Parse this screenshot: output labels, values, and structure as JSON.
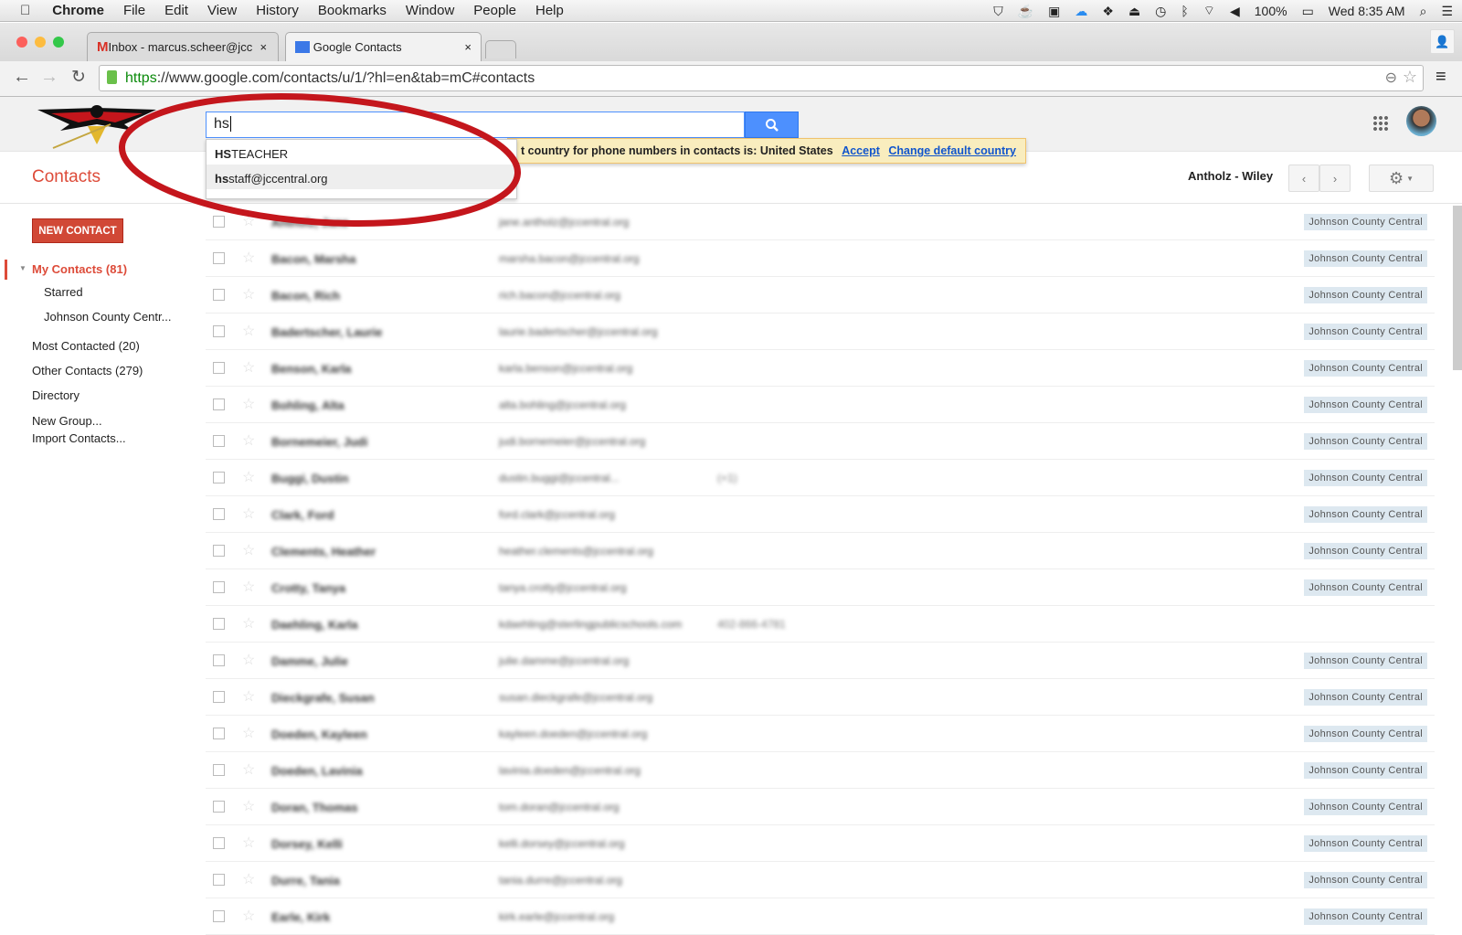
{
  "menubar": {
    "app": "Chrome",
    "items": [
      "File",
      "Edit",
      "View",
      "History",
      "Bookmarks",
      "Window",
      "People",
      "Help"
    ],
    "battery": "100%",
    "clock": "Wed 8:35 AM"
  },
  "tabs": [
    {
      "label": "Inbox - marcus.scheer@jcc",
      "active": false
    },
    {
      "label": "Google Contacts",
      "active": true
    }
  ],
  "url": {
    "scheme": "https",
    "rest": "://www.google.com/contacts/u/1/?hl=en&tab=mC#contacts"
  },
  "search": {
    "value": "hs",
    "suggestions": [
      {
        "bold": "HS",
        "rest": "TEACHER"
      },
      {
        "bold": "hs",
        "rest": "staff@jccentral.org"
      }
    ]
  },
  "notice": {
    "text": "t country for phone numbers in contacts is: United States",
    "accept": "Accept",
    "change": "Change default country"
  },
  "page_title": "Contacts",
  "range": "Antholz - Wiley",
  "new_contact": "NEW CONTACT",
  "sidebar": {
    "my_contacts": "My Contacts (81)",
    "sub": [
      "Starred",
      "Johnson County Centr..."
    ],
    "items": [
      "Most Contacted (20)",
      "Other Contacts (279)",
      "Directory"
    ],
    "links": [
      "New Group...",
      "Import Contacts..."
    ]
  },
  "colors": {
    "accent": "#dd4b39",
    "search_blue": "#4d90fe",
    "annotation": "#c4161c"
  },
  "contacts": [
    {
      "name": "Antholz, Jane",
      "email": "jane.antholz@jccentral.org",
      "tag": "Johnson County Central"
    },
    {
      "name": "Bacon, Marsha",
      "email": "marsha.bacon@jccentral.org",
      "tag": "Johnson County Central"
    },
    {
      "name": "Bacon, Rich",
      "email": "rich.bacon@jccentral.org",
      "tag": "Johnson County Central"
    },
    {
      "name": "Badertscher, Laurie",
      "email": "laurie.badertscher@jccentral.org",
      "tag": "Johnson County Central"
    },
    {
      "name": "Benson, Karla",
      "email": "karla.benson@jccentral.org",
      "tag": "Johnson County Central"
    },
    {
      "name": "Bohling, Alta",
      "email": "alta.bohling@jccentral.org",
      "tag": "Johnson County Central"
    },
    {
      "name": "Bornemeier, Judi",
      "email": "judi.bornemeier@jccentral.org",
      "tag": "Johnson County Central"
    },
    {
      "name": "Buggi, Dustin",
      "email": "dustin.buggi@jccentral...",
      "extra": "(+1)",
      "tag": "Johnson County Central"
    },
    {
      "name": "Clark, Ford",
      "email": "ford.clark@jccentral.org",
      "tag": "Johnson County Central"
    },
    {
      "name": "Clements, Heather",
      "email": "heather.clements@jccentral.org",
      "tag": "Johnson County Central"
    },
    {
      "name": "Crotty, Tanya",
      "email": "tanya.crotty@jccentral.org",
      "tag": "Johnson County Central"
    },
    {
      "name": "Daehling, Karla",
      "email": "kdaehling@sterlingpublicschools.com",
      "extra": "402-866-4781",
      "tag": ""
    },
    {
      "name": "Damme, Julie",
      "email": "julie.damme@jccentral.org",
      "tag": "Johnson County Central"
    },
    {
      "name": "Dieckgrafe, Susan",
      "email": "susan.dieckgrafe@jccentral.org",
      "tag": "Johnson County Central"
    },
    {
      "name": "Doeden, Kayleen",
      "email": "kayleen.doeden@jccentral.org",
      "tag": "Johnson County Central"
    },
    {
      "name": "Doeden, Lavinia",
      "email": "lavinia.doeden@jccentral.org",
      "tag": "Johnson County Central"
    },
    {
      "name": "Doran, Thomas",
      "email": "tom.doran@jccentral.org",
      "tag": "Johnson County Central"
    },
    {
      "name": "Dorsey, Kelli",
      "email": "kelli.dorsey@jccentral.org",
      "tag": "Johnson County Central"
    },
    {
      "name": "Durre, Tania",
      "email": "tania.durre@jccentral.org",
      "tag": "Johnson County Central"
    },
    {
      "name": "Earle, Kirk",
      "email": "kirk.earle@jccentral.org",
      "tag": "Johnson County Central"
    }
  ]
}
